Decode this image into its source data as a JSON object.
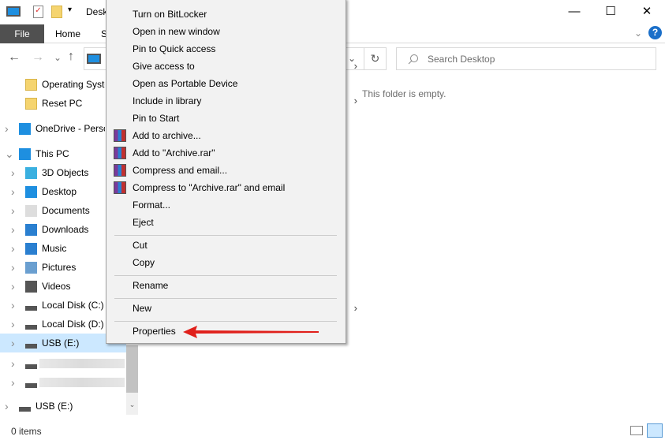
{
  "window": {
    "title": "Desk",
    "minimize": "—",
    "maximize": "☐",
    "close": "✕",
    "help": "?",
    "ribbon_collapse": "⌄"
  },
  "ribbon": {
    "file": "File",
    "home": "Home",
    "share": "S"
  },
  "nav": {
    "back": "←",
    "forward": "→",
    "recent": "⌄",
    "up": "↑",
    "refresh": "↻",
    "addr_dropdown": "⌄"
  },
  "search": {
    "placeholder": "Search Desktop"
  },
  "content": {
    "empty_message": "This folder is empty."
  },
  "sidebar": {
    "items": [
      {
        "label": "Operating Syste",
        "icon": "folder-icon"
      },
      {
        "label": "Reset PC",
        "icon": "folder-icon"
      },
      {
        "label": "OneDrive - Perso",
        "icon": "cloud-icon"
      },
      {
        "label": "This PC",
        "icon": "pc-icon"
      },
      {
        "label": "3D Objects",
        "icon": "cube-icon"
      },
      {
        "label": "Desktop",
        "icon": "desktop-icon"
      },
      {
        "label": "Documents",
        "icon": "document-icon"
      },
      {
        "label": "Downloads",
        "icon": "download-icon"
      },
      {
        "label": "Music",
        "icon": "music-icon"
      },
      {
        "label": "Pictures",
        "icon": "pictures-icon"
      },
      {
        "label": "Videos",
        "icon": "video-icon"
      },
      {
        "label": "Local Disk (C:)",
        "icon": "drive-icon"
      },
      {
        "label": "Local Disk (D:)",
        "icon": "drive-icon"
      },
      {
        "label": "USB (E:)",
        "icon": "drive-icon",
        "selected": true
      },
      {
        "label": "",
        "icon": "drive-icon"
      },
      {
        "label": "",
        "icon": "drive-icon"
      },
      {
        "label": "USB (E:)",
        "icon": "drive-icon"
      }
    ]
  },
  "context_menu": {
    "items": [
      {
        "label": "Turn on BitLocker"
      },
      {
        "label": "Open in new window"
      },
      {
        "label": "Pin to Quick access"
      },
      {
        "label": "Give access to",
        "submenu": true
      },
      {
        "label": "Open as Portable Device"
      },
      {
        "label": "Include in library",
        "submenu": true
      },
      {
        "label": "Pin to Start"
      },
      {
        "label": "Add to archive...",
        "icon": "winrar-icon"
      },
      {
        "label": "Add to \"Archive.rar\"",
        "icon": "winrar-icon"
      },
      {
        "label": "Compress and email...",
        "icon": "winrar-icon"
      },
      {
        "label": "Compress to \"Archive.rar\" and email",
        "icon": "winrar-icon"
      },
      {
        "label": "Format..."
      },
      {
        "label": "Eject"
      },
      {
        "label": "Cut"
      },
      {
        "label": "Copy"
      },
      {
        "label": "Rename"
      },
      {
        "label": "New",
        "submenu": true
      },
      {
        "label": "Properties"
      }
    ],
    "submenu_glyph": "›"
  },
  "status": {
    "items": "0 items"
  },
  "colors": {
    "selection": "#cce8ff",
    "annotation_arrow": "#e0201b",
    "file_tab": "#505050"
  }
}
